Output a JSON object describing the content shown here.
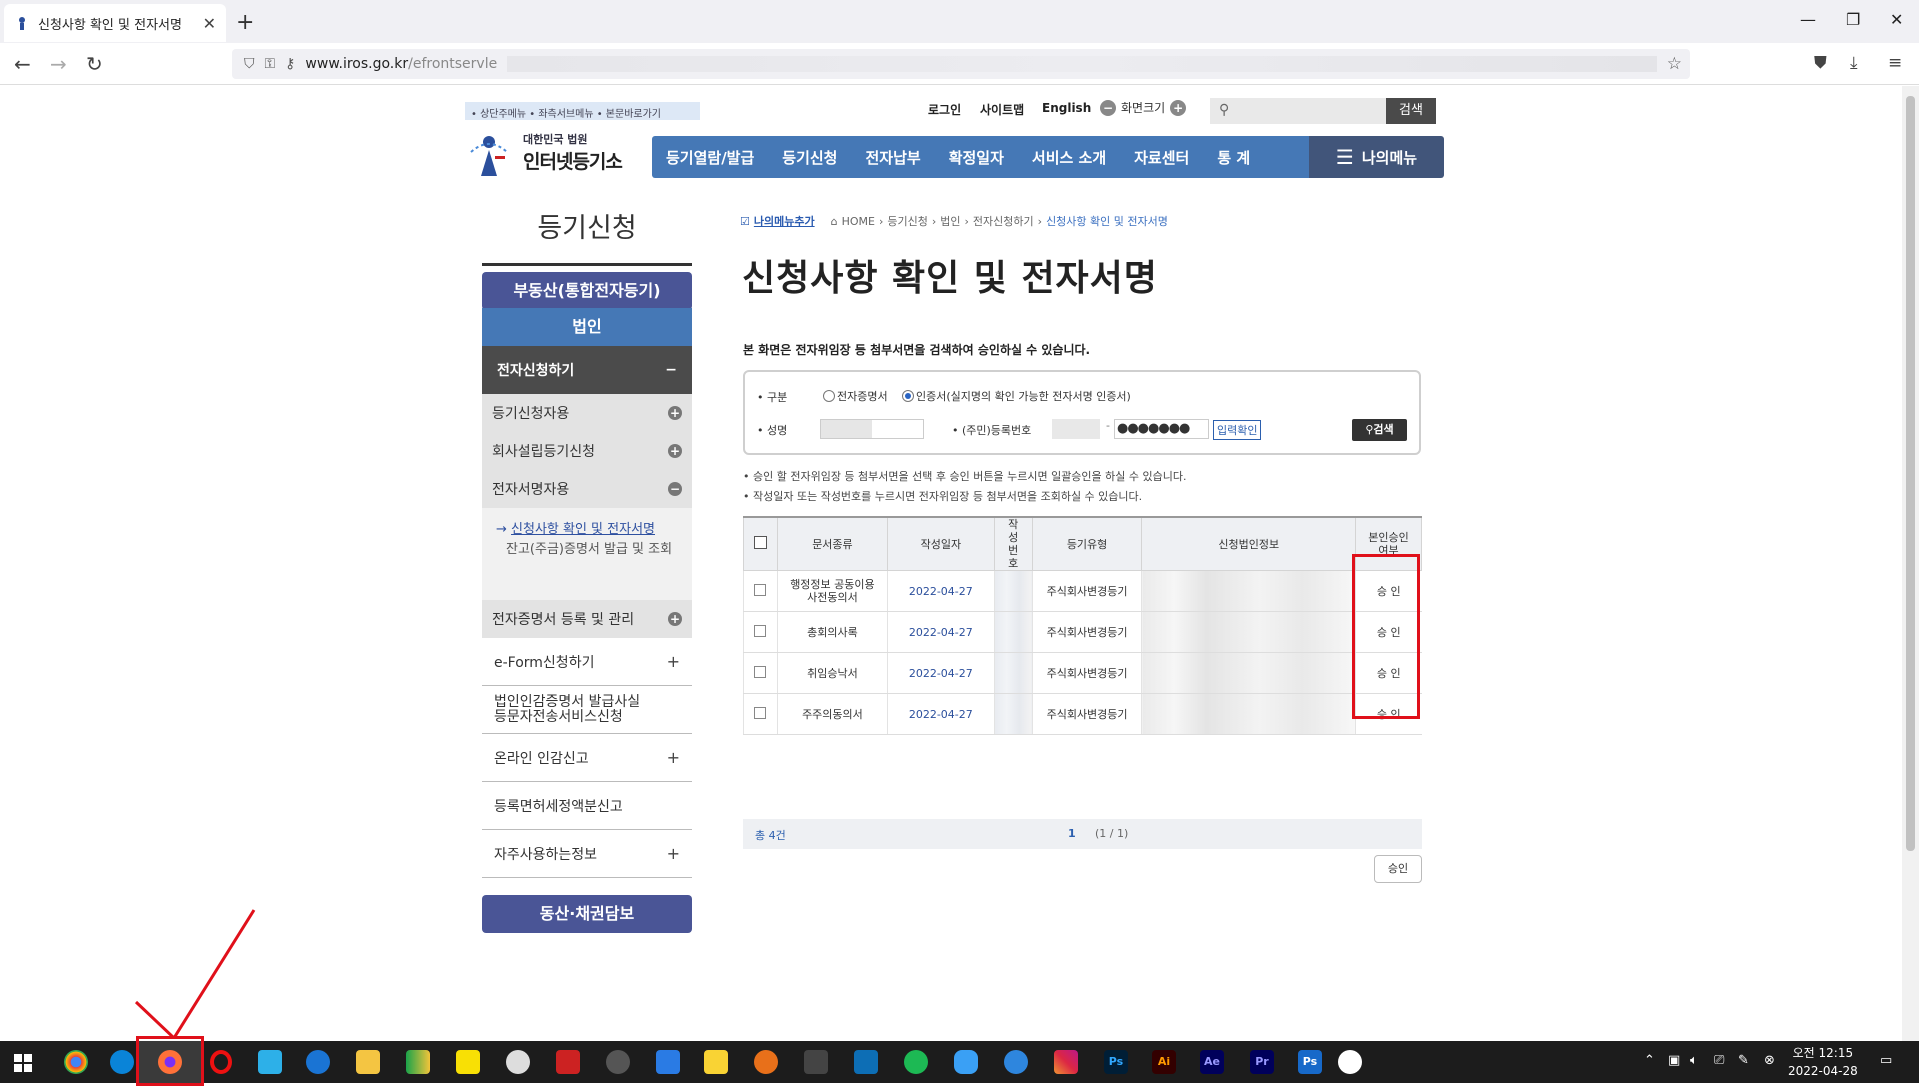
{
  "browser": {
    "tab_title": "신청사항 확인 및 전자서명",
    "url_host": "www.iros.go.kr",
    "url_path": "/efrontservle"
  },
  "header": {
    "skip_links": "• 상단주메뉴 • 좌측서브메뉴 • 본문바로가기",
    "login": "로그인",
    "sitemap": "사이트맵",
    "english": "English",
    "zoom_label": "화면크기",
    "search_button": "검색",
    "logo_small": "대한민국 법원",
    "logo_large": "인터넷등기소",
    "gnb": [
      "등기열람/발급",
      "등기신청",
      "전자납부",
      "확정일자",
      "서비스 소개",
      "자료센터",
      "통 계"
    ],
    "my_menu": "나의메뉴"
  },
  "sidebar": {
    "title": "등기신청",
    "real_estate": "부동산(통합전자등기)",
    "corporation": "법인",
    "e_apply": "전자신청하기",
    "e_apply_toggle": "−",
    "groups": [
      "등기신청자용",
      "회사설립등기신청",
      "전자서명자용"
    ],
    "sub_active": "신청사항 확인 및 전자서명",
    "sub_other": "잔고(주금)증명서 발급 및 조회",
    "cert_mgmt": "전자증명서 등록 및 관리",
    "links": [
      {
        "label": "e-Form신청하기",
        "plus": "+"
      },
      {
        "label": "법인인감증명서 발급사실 등문자전송서비스신청",
        "plus": ""
      },
      {
        "label": "온라인 인감신고",
        "plus": "+"
      },
      {
        "label": "등록면허세정액분신고",
        "plus": ""
      },
      {
        "label": "자주사용하는정보",
        "plus": "+"
      }
    ],
    "movable": "동산·채권담보"
  },
  "content": {
    "breadcrumb_add": "나의메뉴추가",
    "breadcrumb": [
      "HOME",
      "등기신청",
      "법인",
      "전자신청하기"
    ],
    "breadcrumb_current": "신청사항 확인 및 전자서명",
    "title": "신청사항 확인 및 전자서명",
    "desc": "본 화면은 전자위임장 등 첨부서면을 검색하여 승인하실 수 있습니다.",
    "form": {
      "type_label": "• 구분",
      "opt1": "전자증명서",
      "opt2": "인증서(실지명의 확인 가능한 전자서명 인증서)",
      "name_label": "• 성명",
      "reg_label": "• (주민)등록번호",
      "masked": "●●●●●●●",
      "confirm": "입력확인",
      "search": "검색"
    },
    "notes": [
      "• 승인 할 전자위임장 등 첨부서면을 선택 후 승인 버튼을 누르시면 일괄승인을 하실 수 있습니다.",
      "• 작성일자 또는 작성번호를 누르시면 전자위임장 등 첨부서면을 조회하실 수 있습니다."
    ],
    "table": {
      "headers": [
        "문서종류",
        "작성일자",
        "작성번호",
        "등기유형",
        "신청법인정보",
        "본인승인여부"
      ],
      "rows": [
        {
          "doc": "행정정보 공동이용 사전동의서",
          "date": "2022-04-27",
          "type": "주식회사변경등기",
          "status": "승 인"
        },
        {
          "doc": "총회의사록",
          "date": "2022-04-27",
          "type": "주식회사변경등기",
          "status": "승 인"
        },
        {
          "doc": "취임승낙서",
          "date": "2022-04-27",
          "type": "주식회사변경등기",
          "status": "승 인"
        },
        {
          "doc": "주주의동의서",
          "date": "2022-04-27",
          "type": "주식회사변경등기",
          "status": "승 인"
        }
      ],
      "total": "총 4건",
      "page": "1",
      "page_info": "(1 / 1)"
    },
    "approve_button": "승인"
  },
  "taskbar": {
    "clock_time": "오전 12:15",
    "clock_date": "2022-04-28"
  },
  "colors": {
    "gnb": "#4578b6",
    "sidebar_blue": "#4a5596",
    "annotation_red": "#e0101a"
  }
}
